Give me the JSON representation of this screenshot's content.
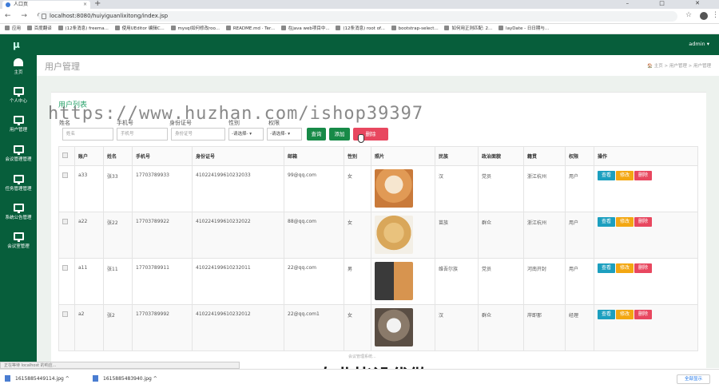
{
  "browser": {
    "tab_title": "人口页",
    "new_tab": "+",
    "window_controls": "–  □  ✕",
    "url": "localhost:8080/huiyiguanlixitong/index.jsp",
    "bookmarks": [
      "应用",
      "百度翻译",
      "(12条消息) freema...",
      "使用UEditor 编辑C...",
      "mysql如何修改roo...",
      "README.md · Ter...",
      "在java web项目中...",
      "(12条消息) root of...",
      "bootstrap-select...",
      "如何用正则匹配: 2...",
      "layDate - 日日期与..."
    ]
  },
  "app": {
    "logo": "μ",
    "user": "admin ▾",
    "sidebar": [
      {
        "label": "主页",
        "icon": "gauge-icon"
      },
      {
        "label": "个人中心",
        "icon": "monitor-icon"
      },
      {
        "label": "用户管理",
        "icon": "monitor-icon"
      },
      {
        "label": "会议管理管理",
        "icon": "monitor-icon"
      },
      {
        "label": "任务管理管理",
        "icon": "monitor-icon"
      },
      {
        "label": "系统公告管理",
        "icon": "monitor-icon"
      },
      {
        "label": "会议室管理",
        "icon": "monitor-icon"
      }
    ],
    "page_title": "用户管理",
    "breadcrumb": "🏠 主页  >  用户管理  >  用户管理"
  },
  "panel": {
    "title": "用户列表",
    "filters": {
      "labels": [
        "姓名",
        "手机号",
        "身份证号",
        "性别",
        "权限"
      ],
      "name_placeholder": "姓名",
      "phone_placeholder": "手机号",
      "idcard_placeholder": "身份证号",
      "select1": "-请选择-",
      "select2": "-请选择-"
    },
    "buttons": {
      "search": "查询",
      "add": "添加",
      "delete": "删除"
    }
  },
  "table": {
    "headers": [
      "",
      "账户",
      "姓名",
      "手机号",
      "身份证号",
      "邮箱",
      "性别",
      "照片",
      "民族",
      "政治面貌",
      "籍贯",
      "权限",
      "操作"
    ],
    "rows": [
      {
        "account": "a33",
        "name": "张33",
        "phone": "17703789933",
        "idcard": "410224199610232033",
        "email": "99@qq.com",
        "gender": "女",
        "photo": "shiba-dog",
        "ethnic": "汉",
        "politics": "党员",
        "hometown": "浙江杭州",
        "role": "用户"
      },
      {
        "account": "a22",
        "name": "张22",
        "phone": "17703789922",
        "idcard": "410224199610232022",
        "email": "88@qq.com",
        "gender": "女",
        "photo": "golden-puppy",
        "ethnic": "苗族",
        "politics": "群众",
        "hometown": "浙江杭州",
        "role": "用户"
      },
      {
        "account": "a11",
        "name": "张11",
        "phone": "17703789911",
        "idcard": "410224199610232011",
        "email": "22@qq.com",
        "gender": "男",
        "photo": "husky-shiba",
        "ethnic": "维吾尔族",
        "politics": "党员",
        "hometown": "河南开封",
        "role": "用户"
      },
      {
        "account": "a2",
        "name": "张2",
        "phone": "17703789992",
        "idcard": "410224199610232012",
        "email": "22@qq.com1",
        "gender": "女",
        "photo": "tabby-cat",
        "ethnic": "汉",
        "politics": "群众",
        "hometown": "岸即那",
        "role": "经理"
      }
    ],
    "actions": {
      "view": "查看",
      "edit": "修改",
      "delete": "删除"
    }
  },
  "overlay": {
    "watermark": "https://www.huzhan.com/ishop39397",
    "caption": "专业毕设代做",
    "footer_partial": "会议管理系统..."
  },
  "status_bar": "正在等待 localhost 的响应...",
  "downloads": {
    "items": [
      "1615885449114.jpg",
      "1615885483940.jpg"
    ],
    "show_all": "全部显示"
  },
  "colors": {
    "primary_green": "#075e3b",
    "accent_green": "#178a47",
    "danger": "#e8475f",
    "info": "#1c9fbf",
    "warning": "#f3a712"
  }
}
